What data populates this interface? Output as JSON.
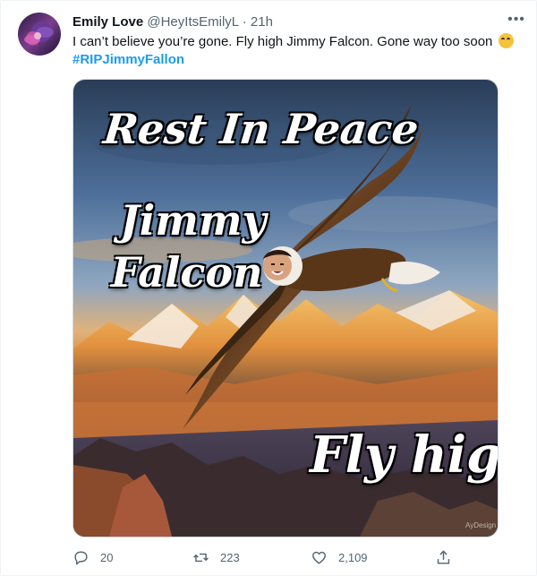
{
  "author": {
    "display_name": "Emily Love",
    "handle": "@HeyItsEmilyL",
    "separator": "·",
    "time": "21h"
  },
  "tweet": {
    "text": "I can’t believe you’re gone. Fly high Jimmy Falcon. Gone way too soon",
    "emoji_icon": "rolling-eyes-emoji",
    "hashtag": "#RIPJimmyFallon"
  },
  "media": {
    "line1": "Rest In Peace",
    "line2": "Jimmy",
    "line3": "Falcon",
    "line4": "Fly high",
    "artist_signature": "AyDesign"
  },
  "actions": {
    "reply_count": "20",
    "retweet_count": "223",
    "like_count": "2,109"
  },
  "colors": {
    "link": "#1d9bf0",
    "text": "#0f1419",
    "secondary": "#536471"
  }
}
